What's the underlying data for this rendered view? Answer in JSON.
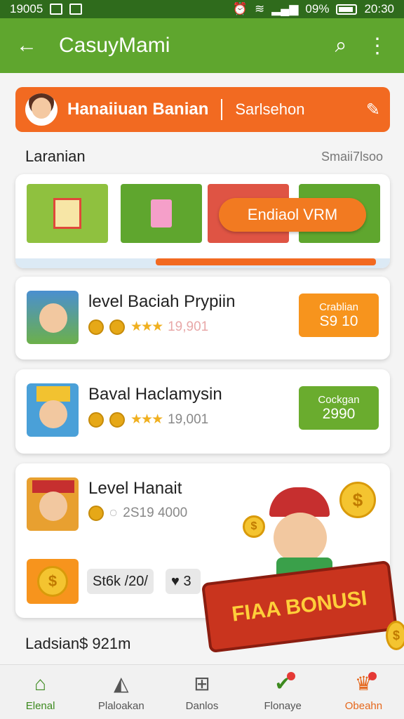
{
  "status_bar": {
    "time": "19005",
    "battery_pct": "09%",
    "clock": "20:30"
  },
  "app_bar": {
    "title": "CasuyMami"
  },
  "banner": {
    "title": "Hanaiiuan Banian",
    "action": "Sarlsehon"
  },
  "section1": {
    "heading": "Laranian",
    "aux": "Smaii7lsoo"
  },
  "carousel": {
    "pill": "Endiaol VRM"
  },
  "cards": [
    {
      "name": "level Baciah Prypiin",
      "count": "19,901",
      "btn_sub": "Crablian",
      "btn_val": "S9 10"
    },
    {
      "name": "Baval Haclamysin",
      "count": "19,001",
      "btn_sub": "Cockgan",
      "btn_val": "2990"
    },
    {
      "name": "Level Hanait",
      "count": "2S19 4000",
      "chip1": "St6k /20/",
      "chip2": "3"
    }
  ],
  "promo": {
    "label": "FIAA BONUSI"
  },
  "section2": {
    "heading": "Ladsian$ 921m"
  },
  "nav": [
    {
      "label": "Elenal",
      "icon": "home-icon"
    },
    {
      "label": "Plaloakan",
      "icon": "chart-icon"
    },
    {
      "label": "Danlos",
      "icon": "grid-icon"
    },
    {
      "label": "Flonaye",
      "icon": "check-icon"
    },
    {
      "label": "Obeahn",
      "icon": "trophy-icon"
    }
  ],
  "colors": {
    "primary": "#5fa62e",
    "accent": "#f26a21",
    "status_bar": "#2f6b1c"
  }
}
